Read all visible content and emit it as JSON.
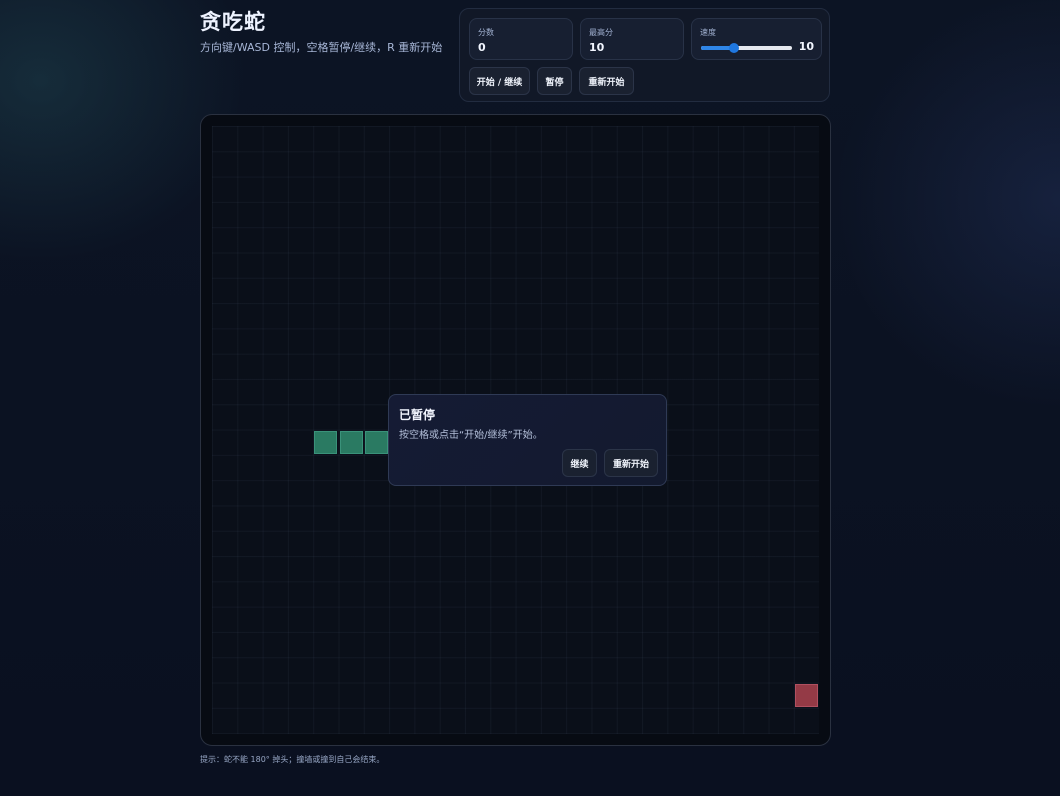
{
  "header": {
    "title": "贪吃蛇",
    "subtitle": "方向键/WASD 控制，空格暂停/继续，R 重新开始"
  },
  "stats": {
    "score_label": "分数",
    "score_value": "0",
    "best_label": "最高分",
    "best_value": "10",
    "speed_label": "速度",
    "speed_value": "10",
    "speed_level": 0.36
  },
  "controls": {
    "start_label": "开始 / 继续",
    "pause_label": "暂停",
    "restart_label": "重新开始"
  },
  "board": {
    "grid_size": 24,
    "snake": [
      {
        "col": 4,
        "row": 12
      },
      {
        "col": 5,
        "row": 12
      },
      {
        "col": 6,
        "row": 12
      }
    ],
    "food": {
      "col": 23,
      "row": 22
    },
    "colors": {
      "snake": "#2a7a62",
      "food": "#943a46"
    }
  },
  "pause_dialog": {
    "title": "已暂停",
    "message": "按空格或点击“开始/继续”开始。",
    "continue_label": "继续",
    "restart_label": "重新开始"
  },
  "footer": {
    "hint": "提示：蛇不能 180° 掉头；撞墙或撞到自己会结束。"
  }
}
